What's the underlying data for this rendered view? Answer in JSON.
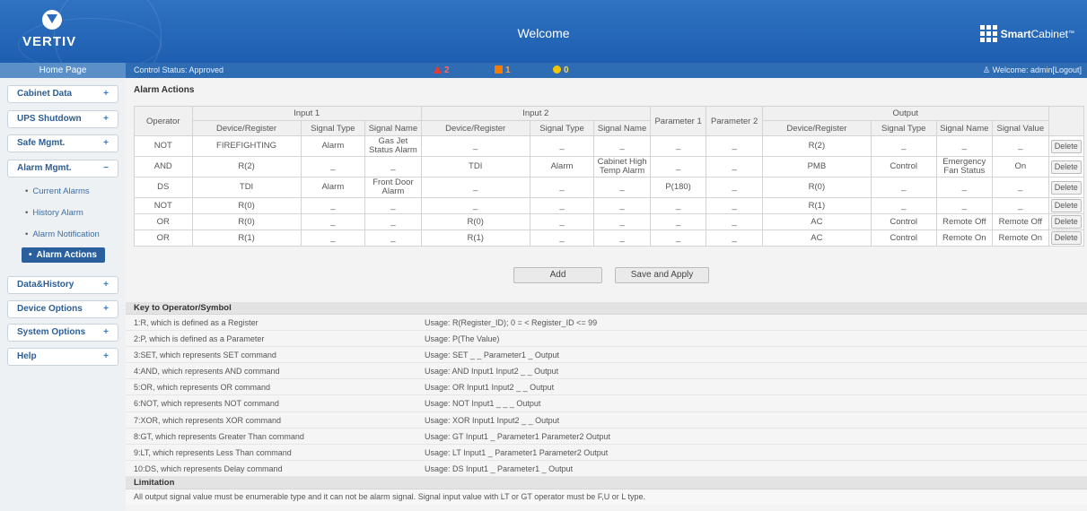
{
  "header": {
    "logo": "VERTIV",
    "title": "Welcome",
    "brand_bold": "Smart",
    "brand_rest": "Cabinet",
    "brand_tm": "™"
  },
  "statusbar": {
    "home": "Home Page",
    "control": "Control Status:  Approved",
    "alarm_critical": "2",
    "alarm_major": "1",
    "alarm_minor": "0",
    "welcome": "Welcome: admin[Logout]",
    "colors": {
      "critical": "#e53935",
      "major": "#f57c00",
      "minor": "#f5c400"
    }
  },
  "sidebar": {
    "cabinet_data": "Cabinet Data",
    "ups_shutdown": "UPS Shutdown",
    "safe_mgmt": "Safe Mgmt.",
    "alarm_mgmt": "Alarm Mgmt.",
    "sub": [
      "Current Alarms",
      "History Alarm",
      "Alarm Notification"
    ],
    "active": "Alarm Actions",
    "data_history": "Data&History",
    "device_options": "Device Options",
    "system_options": "System Options",
    "help": "Help",
    "plus": "+",
    "minus": "−"
  },
  "actions": {
    "title": "Alarm Actions",
    "group_headers": {
      "operator": "Operator",
      "input1": "Input 1",
      "input2": "Input 2",
      "param1": "Parameter 1",
      "param2": "Parameter 2",
      "output": "Output"
    },
    "sub_headers": {
      "dev": "Device/Register",
      "stype": "Signal Type",
      "sname": "Signal Name",
      "svalue": "Signal Value"
    },
    "delete_label": "Delete",
    "rows": [
      {
        "op": "NOT",
        "i1d": "FIREFIGHTING",
        "i1t": "Alarm",
        "i1n": "Gas Jet Status Alarm",
        "i2d": "_",
        "i2t": "_",
        "i2n": "_",
        "p1": "_",
        "p2": "_",
        "od": "R(2)",
        "ot": "_",
        "on": "_",
        "ov": "_"
      },
      {
        "op": "AND",
        "i1d": "R(2)",
        "i1t": "_",
        "i1n": "_",
        "i2d": "TDI",
        "i2t": "Alarm",
        "i2n": "Cabinet High Temp Alarm",
        "p1": "_",
        "p2": "_",
        "od": "PMB",
        "ot": "Control",
        "on": "Emergency Fan Status",
        "ov": "On"
      },
      {
        "op": "DS",
        "i1d": "TDI",
        "i1t": "Alarm",
        "i1n": "Front Door Alarm",
        "i2d": "_",
        "i2t": "_",
        "i2n": "_",
        "p1": "P(180)",
        "p2": "_",
        "od": "R(0)",
        "ot": "_",
        "on": "_",
        "ov": "_"
      },
      {
        "op": "NOT",
        "i1d": "R(0)",
        "i1t": "_",
        "i1n": "_",
        "i2d": "_",
        "i2t": "_",
        "i2n": "_",
        "p1": "_",
        "p2": "_",
        "od": "R(1)",
        "ot": "_",
        "on": "_",
        "ov": "_"
      },
      {
        "op": "OR",
        "i1d": "R(0)",
        "i1t": "_",
        "i1n": "_",
        "i2d": "R(0)",
        "i2t": "_",
        "i2n": "_",
        "p1": "_",
        "p2": "_",
        "od": "AC",
        "ot": "Control",
        "on": "Remote Off",
        "ov": "Remote Off"
      },
      {
        "op": "OR",
        "i1d": "R(1)",
        "i1t": "_",
        "i1n": "_",
        "i2d": "R(1)",
        "i2t": "_",
        "i2n": "_",
        "p1": "_",
        "p2": "_",
        "od": "AC",
        "ot": "Control",
        "on": "Remote On",
        "ov": "Remote On"
      }
    ],
    "add": "Add",
    "save": "Save and Apply"
  },
  "key": {
    "title": "Key to Operator/Symbol",
    "rows": [
      [
        "1:R, which is defined as a Register",
        "Usage: R(Register_ID); 0 = < Register_ID <= 99"
      ],
      [
        "2:P, which is defined as a Parameter",
        "Usage: P(The Value)"
      ],
      [
        "3:SET, which represents SET command",
        "Usage: SET _ _ Parameter1 _ Output"
      ],
      [
        "4:AND, which represents AND command",
        "Usage: AND Input1 Input2 _ _ Output"
      ],
      [
        "5:OR, which represents OR command",
        "Usage: OR Input1 Input2 _ _ Output"
      ],
      [
        "6:NOT, which represents NOT command",
        "Usage: NOT Input1 _ _ _ Output"
      ],
      [
        "7:XOR, which represents XOR command",
        "Usage: XOR Input1 Input2 _ _ Output"
      ],
      [
        "8:GT, which represents Greater Than command",
        "Usage: GT Input1 _ Parameter1 Parameter2 Output"
      ],
      [
        "9:LT, which represents Less Than command",
        "Usage: LT Input1 _ Parameter1 Parameter2 Output"
      ],
      [
        "10:DS, which represents Delay command",
        "Usage: DS Input1 _ Parameter1 _ Output"
      ]
    ],
    "limitation_title": "Limitation",
    "limitation_text": "All output signal value must be enumerable type and it can not be alarm signal.   Signal input value with LT or GT operator must be F,U or L type."
  }
}
